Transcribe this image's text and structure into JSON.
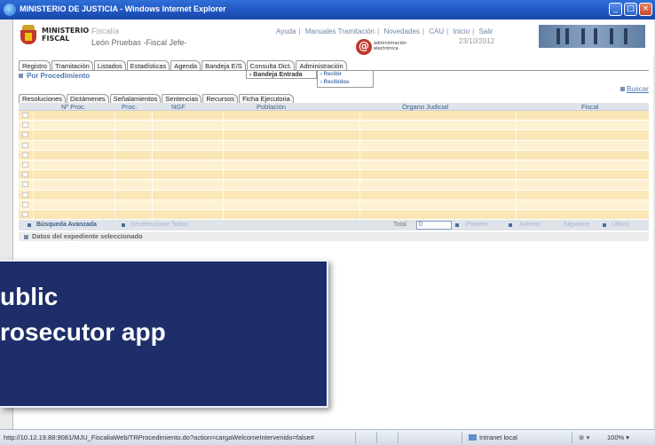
{
  "window": {
    "title": "MINISTERIO DE JUSTICIA - Windows Internet Explorer",
    "buttons": {
      "minimize": "_",
      "maximize": "□",
      "close": "×"
    }
  },
  "header": {
    "ministry": "MINISTERIO\nFISCAL",
    "app_name": "Fiscalía",
    "user": "León Pruebas -Fiscal Jefe-",
    "links": [
      "Ayuda",
      "Manuales Tramitación",
      "Novedades",
      "CAU",
      "Inicio",
      "Salir"
    ],
    "date": "23/10/2012",
    "ae_logo": "@",
    "ae_text": "administración\nelectrónica"
  },
  "menu": [
    "Registro",
    "Tramitación",
    "Listados",
    "Estadísticas",
    "Agenda",
    "Bandeja E/S",
    "Consulta Dict.",
    "Administración"
  ],
  "dropdown": {
    "item": "› Bandeja Entrada",
    "sub": [
      "› Recibir",
      "› Recibidos"
    ]
  },
  "section": {
    "title": "Por Procedimiento",
    "buscar": "Buscar"
  },
  "subtabs": [
    "Resoluciones",
    "Dictámenes",
    "Señalamientos",
    "Sentencias",
    "Recursos",
    "Ficha Ejecutoria"
  ],
  "table": {
    "columns": [
      "Nº Proc.",
      "Proc.",
      "NGF",
      "Población",
      "Órgano Judicial",
      "Fiscal"
    ],
    "row_count": 11
  },
  "pager": {
    "advanced": "Búsqueda Avanzada",
    "deselect": "Deseleccionar Todos",
    "total_label": "Total",
    "total_value": "0",
    "first": "Primero",
    "prev": "Anterior",
    "next": "Siguiente",
    "last": "Último"
  },
  "details": "Datos del expediente seleccionado",
  "overlay": {
    "text": "ublic\nrosecutor app"
  },
  "statusbar": {
    "url": "http://10.12.19.88:9081/MJU_FiscaliaWeb/TRProcedimiento.do?action=cargaWelcomeIntervenido=false#",
    "zone": "Intranet local",
    "favorites": "⊕ ▾",
    "zoom": "100%  ▾"
  },
  "colors": {
    "titlebar": "#1f55c0",
    "row_a": "#fbe7b6",
    "row_b": "#fdf1d2",
    "overlay": "#1e2e6a",
    "link": "#4a78b0"
  }
}
